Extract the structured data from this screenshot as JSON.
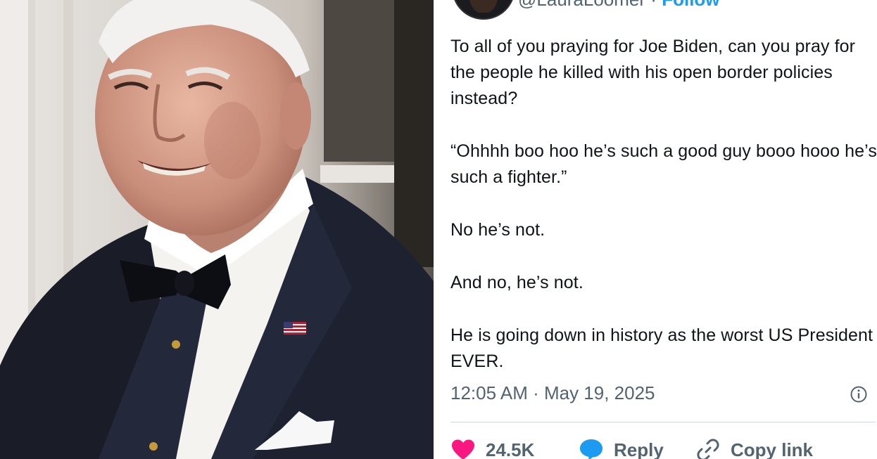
{
  "photo": {
    "subject": "photo"
  },
  "tweet": {
    "handle": "@LauraLoomer",
    "separator": "·",
    "follow_label": "Follow",
    "paragraphs": [
      "To all of you praying for Joe Biden, can you pray for the people he killed with his open border policies instead?",
      "“Ohhhh boo hoo he’s such a good guy booo hooo he’s such a fighter.”",
      "No he’s not.",
      "And no, he’s not.",
      "He is going down in history as the worst US President EVER."
    ],
    "timestamp": "12:05 AM · May 19, 2025",
    "likes": "24.5K",
    "reply_label": "Reply",
    "copy_link_label": "Copy link"
  },
  "icons": {
    "info": "info-circle-icon",
    "heart": "heart-icon",
    "reply": "speech-bubble-icon",
    "link": "link-icon"
  },
  "colors": {
    "text": "#0f1419",
    "muted": "#536471",
    "link_blue": "#1d9bf0",
    "heart": "#f91880",
    "rule": "#cfd9de"
  }
}
